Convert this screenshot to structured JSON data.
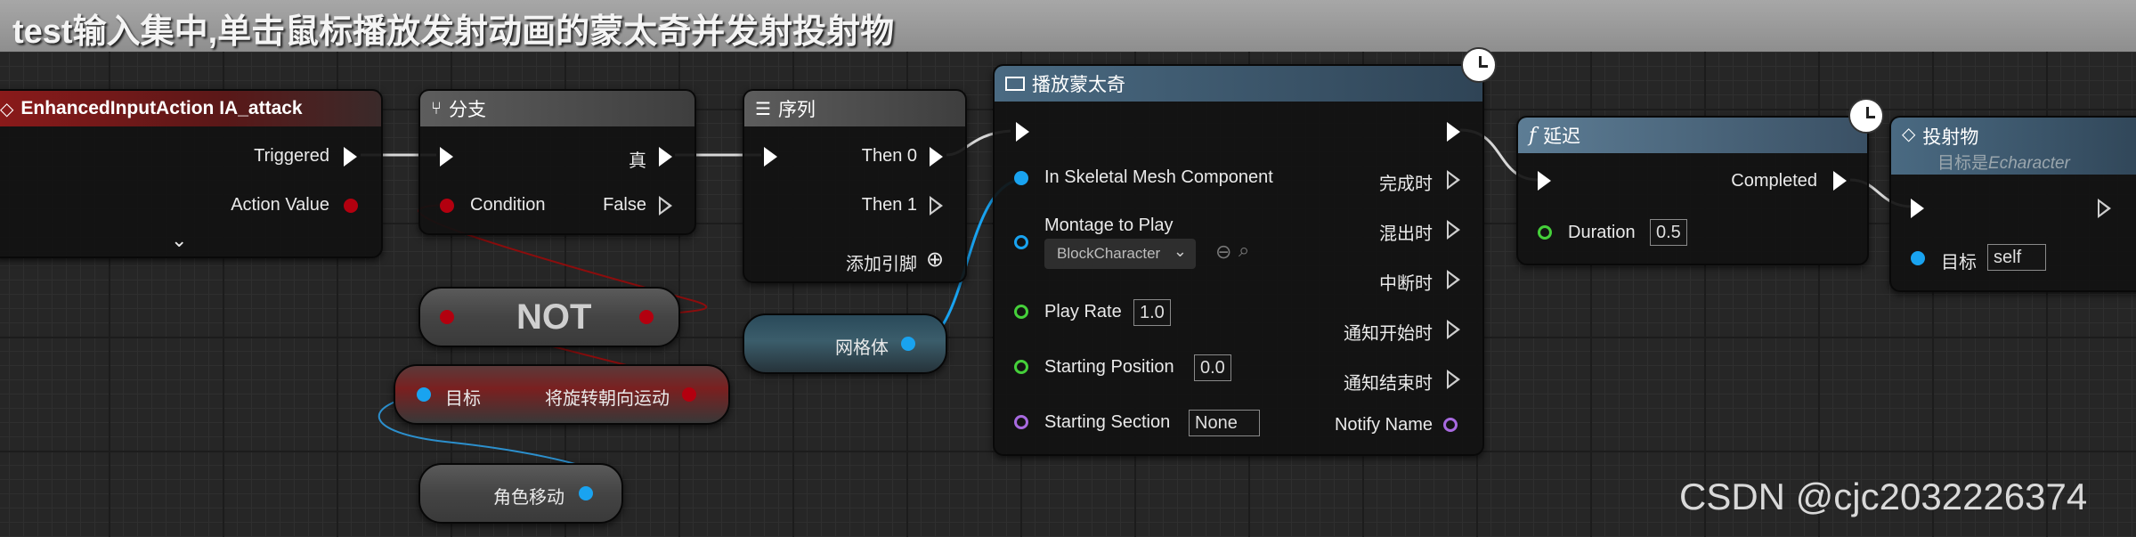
{
  "comment": {
    "title": "test输入集中,单击鼠标播放发射动画的蒙太奇并发射投射物"
  },
  "input_node": {
    "title": "EnhancedInputAction IA_attack",
    "triggered": "Triggered",
    "action_value": "Action Value"
  },
  "branch_node": {
    "title": "分支",
    "condition": "Condition",
    "true_label": "真",
    "false_label": "False"
  },
  "sequence_node": {
    "title": "序列",
    "then0": "Then 0",
    "then1": "Then 1",
    "add_pin": "添加引脚"
  },
  "not_node": {
    "title": "NOT"
  },
  "orient_node": {
    "target": "目标",
    "output": "将旋转朝向运动"
  },
  "movement_node": {
    "output": "角色移动"
  },
  "mesh_node": {
    "output": "网格体"
  },
  "montage_node": {
    "title": "播放蒙太奇",
    "skeletal_mesh": "In Skeletal Mesh Component",
    "montage_to_play": "Montage to Play",
    "montage_value": "BlockCharacter",
    "play_rate": "Play Rate",
    "play_rate_value": "1.0",
    "starting_position": "Starting Position",
    "starting_position_value": "0.0",
    "starting_section": "Starting Section",
    "starting_section_value": "None",
    "on_completed": "完成时",
    "on_blend_out": "混出时",
    "on_interrupted": "中断时",
    "notify_begin": "通知开始时",
    "notify_end": "通知结束时",
    "notify_name": "Notify Name"
  },
  "delay_node": {
    "title": "延迟",
    "completed": "Completed",
    "duration": "Duration",
    "duration_value": "0.5"
  },
  "projectile_node": {
    "title": "投射物",
    "subtitle_prefix": "目标是",
    "subtitle_class": "Echaracter",
    "target": "目标",
    "target_value": "self"
  },
  "watermark": "CSDN @cjc2032226374",
  "colors": {
    "exec": "#ffffff",
    "bool": "#b3000f",
    "object": "#19a3f0",
    "float": "#45d03a",
    "name": "#a86ae0"
  }
}
